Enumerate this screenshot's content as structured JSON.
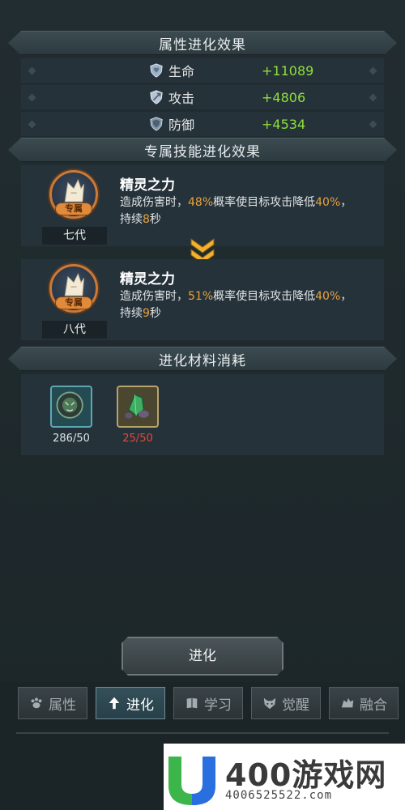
{
  "sections": {
    "attr_title": "属性进化效果",
    "skill_title": "专属技能进化效果",
    "material_title": "进化材料消耗"
  },
  "stats": [
    {
      "name": "生命",
      "value": "+11089",
      "icon": "heart-shield-icon"
    },
    {
      "name": "攻击",
      "value": "+4806",
      "icon": "attack-shield-icon"
    },
    {
      "name": "防御",
      "value": "+4534",
      "icon": "defense-shield-icon"
    }
  ],
  "skills": [
    {
      "badge": "专属",
      "generation": "七代",
      "title": "精灵之力",
      "desc_parts": [
        "造成伤害时，",
        "48%",
        "概率使目标攻击降低",
        "40%",
        "，",
        "持续",
        "8",
        "秒"
      ]
    },
    {
      "badge": "专属",
      "generation": "八代",
      "title": "精灵之力",
      "desc_parts": [
        "造成伤害时，",
        "51%",
        "概率使目标攻击降低",
        "40%",
        "，",
        "持续",
        "9",
        "秒"
      ]
    }
  ],
  "materials": [
    {
      "count": "286/50",
      "color": "#dfe4e6",
      "icon": "green-beast-token-icon"
    },
    {
      "count": "25/50",
      "color": "#e04a3a",
      "icon": "green-crystal-ore-icon"
    }
  ],
  "evolve_button": "进化",
  "tabs": [
    {
      "label": "属性",
      "icon": "paw-icon",
      "active": false
    },
    {
      "label": "进化",
      "icon": "evolve-arrow-icon",
      "active": true
    },
    {
      "label": "学习",
      "icon": "book-icon",
      "active": false
    },
    {
      "label": "觉醒",
      "icon": "fox-face-icon",
      "active": false
    },
    {
      "label": "融合",
      "icon": "beast-fusion-icon",
      "active": false
    }
  ],
  "watermark": {
    "brand": "400游戏网",
    "phone": "4006525522.com"
  },
  "colors": {
    "background": "#1f2a2e",
    "panel": "#26323a",
    "positive": "#8ee03a",
    "highlight": "#e9a23b",
    "insufficient": "#e04a3a"
  }
}
